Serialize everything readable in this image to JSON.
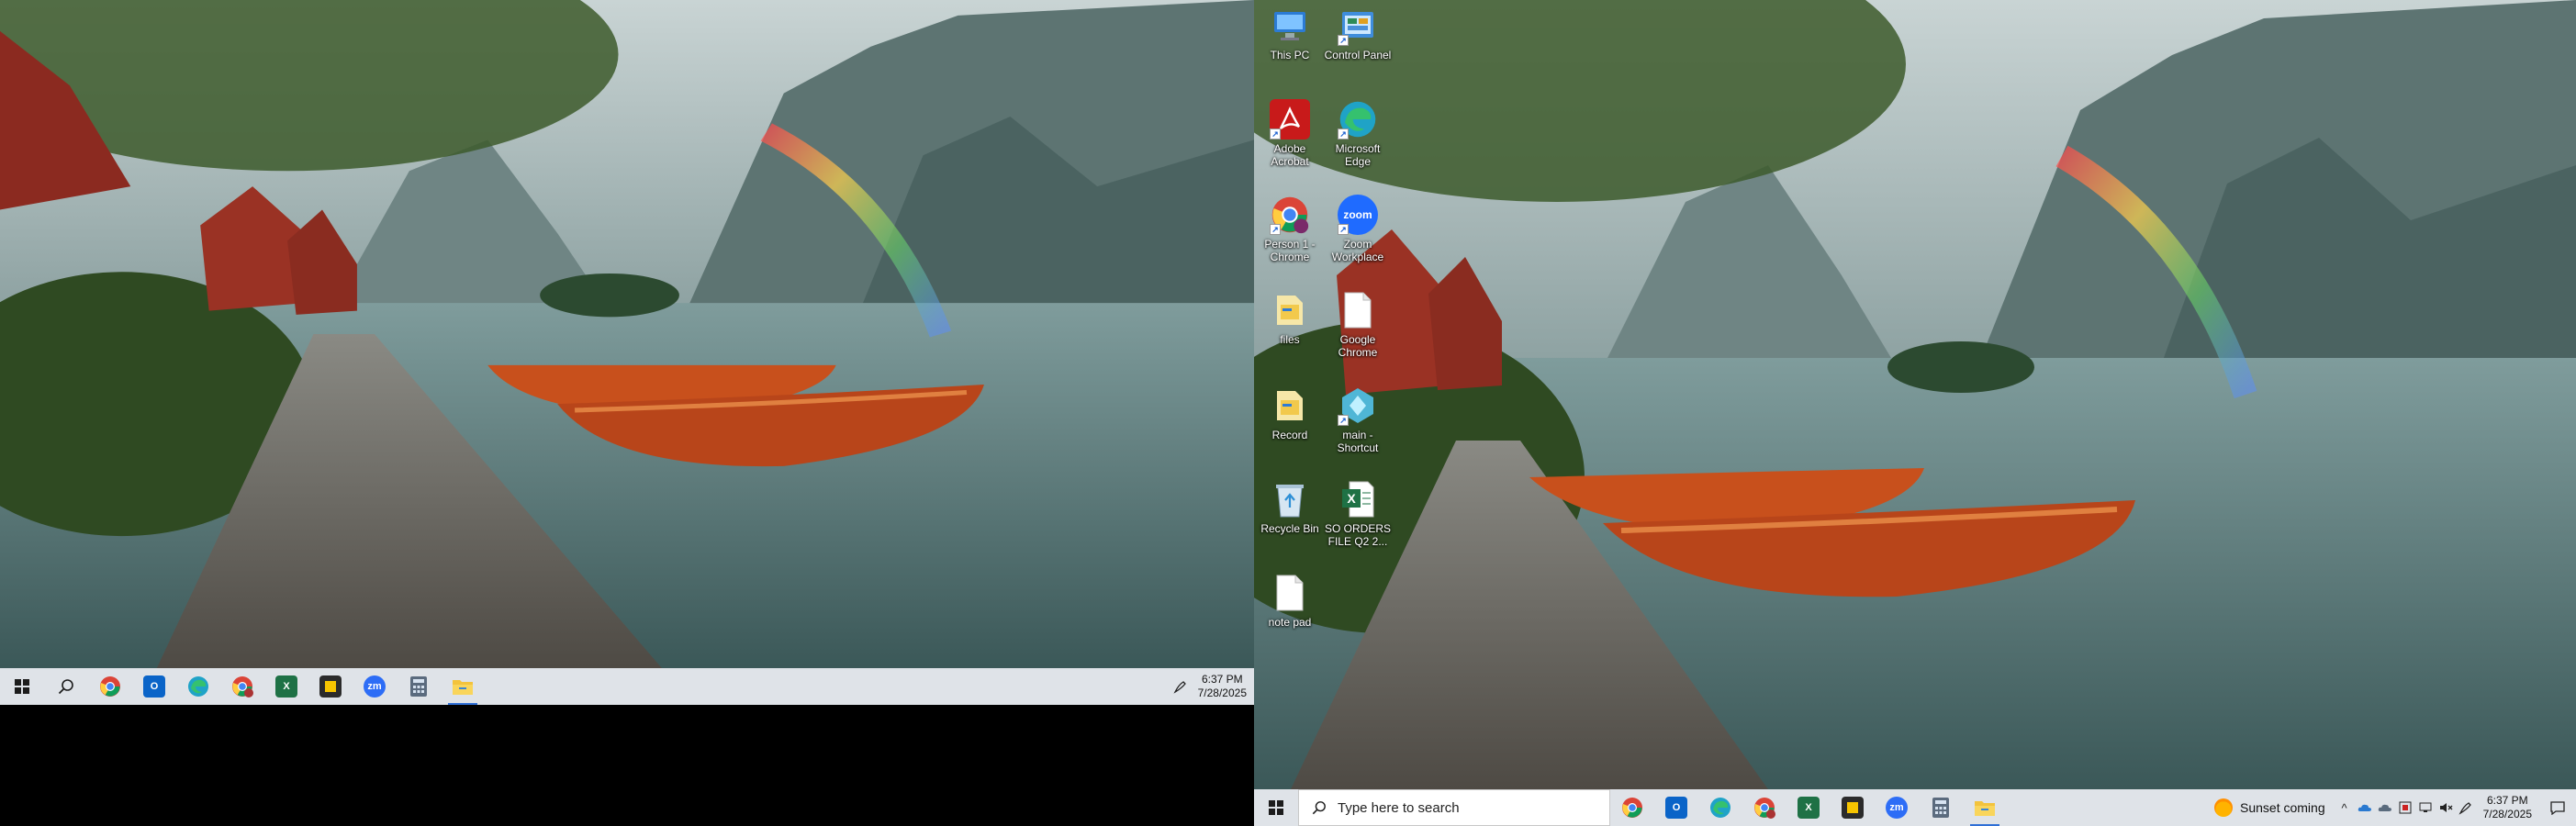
{
  "monitor1": {
    "taskbar": {
      "apps": [
        {
          "name": "chrome",
          "icon": "chrome-icon",
          "active": false
        },
        {
          "name": "outlook",
          "icon": "outlook-icon",
          "active": false
        },
        {
          "name": "edge",
          "icon": "edge-icon",
          "active": false
        },
        {
          "name": "chrome-person1",
          "icon": "chrome-person-icon",
          "active": false
        },
        {
          "name": "excel",
          "icon": "excel-icon",
          "active": false
        },
        {
          "name": "sticky-notes",
          "icon": "sticky-notes-icon",
          "active": false
        },
        {
          "name": "zoom",
          "icon": "zoom-icon",
          "active": false
        },
        {
          "name": "calculator",
          "icon": "calculator-icon",
          "active": false
        },
        {
          "name": "file-explorer",
          "icon": "folder-icon",
          "active": true
        }
      ],
      "clock": {
        "time": "6:37 PM",
        "date": "7/28/2025"
      }
    }
  },
  "monitor2": {
    "desktop_icons": [
      {
        "label": "This PC",
        "icon": "this-pc-icon"
      },
      {
        "label": "Control Panel",
        "icon": "control-panel-icon"
      },
      {
        "label": "Adobe Acrobat",
        "icon": "acrobat-icon"
      },
      {
        "label": "Microsoft Edge",
        "icon": "edge-icon"
      },
      {
        "label": "Person 1 - Chrome",
        "icon": "chrome-person-icon"
      },
      {
        "label": "Zoom Workplace",
        "icon": "zoom-icon"
      },
      {
        "label": "files",
        "icon": "folder-icon"
      },
      {
        "label": "Google Chrome",
        "icon": "document-icon"
      },
      {
        "label": "Record",
        "icon": "folder-icon"
      },
      {
        "label": "main - Shortcut",
        "icon": "shortcut-icon"
      },
      {
        "label": "Recycle Bin",
        "icon": "recycle-bin-icon"
      },
      {
        "label": "SO ORDERS FILE Q2 2...",
        "icon": "excel-file-icon"
      },
      {
        "label": "note pad",
        "icon": "document-icon"
      }
    ],
    "taskbar": {
      "search_placeholder": "Type here to search",
      "weather": "Sunset coming",
      "clock": {
        "time": "6:37 PM",
        "date": "7/28/2025"
      },
      "zoom_text": "zm",
      "zoom_label": "zoom"
    }
  },
  "colors": {
    "taskbar_bg": "#dfe3e8",
    "accent": "#2f6fd6"
  }
}
